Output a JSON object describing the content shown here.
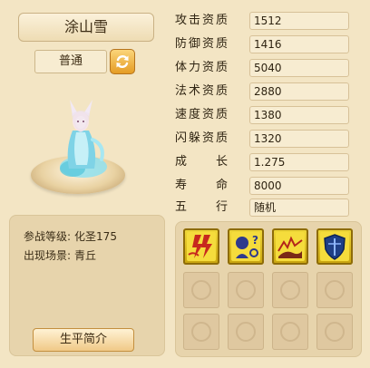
{
  "character": {
    "name": "涂山雪",
    "grade": "普通"
  },
  "stats": [
    {
      "label": "攻击资质",
      "value": "1512"
    },
    {
      "label": "防御资质",
      "value": "1416"
    },
    {
      "label": "体力资质",
      "value": "5040"
    },
    {
      "label": "法术资质",
      "value": "2880"
    },
    {
      "label": "速度资质",
      "value": "1380"
    },
    {
      "label": "闪躲资质",
      "value": "1320"
    },
    {
      "label": "成长",
      "value": "1.275"
    },
    {
      "label": "寿命",
      "value": "8000"
    },
    {
      "label": "五行",
      "value": "随机"
    }
  ],
  "info": {
    "battle_level_label": "参战等级:",
    "battle_level_value": "化圣175",
    "appear_label": "出现场景:",
    "appear_value": "青丘"
  },
  "bio_button": "生平简介",
  "skills": [
    {
      "icon": "lightning-strike-icon"
    },
    {
      "icon": "mystic-orb-icon"
    },
    {
      "icon": "beast-charge-icon"
    },
    {
      "icon": "shield-icon"
    }
  ],
  "colors": {
    "background": "#f3e5c4",
    "skill_gold": "#e6c51f",
    "button_orange": "#e59c24"
  }
}
